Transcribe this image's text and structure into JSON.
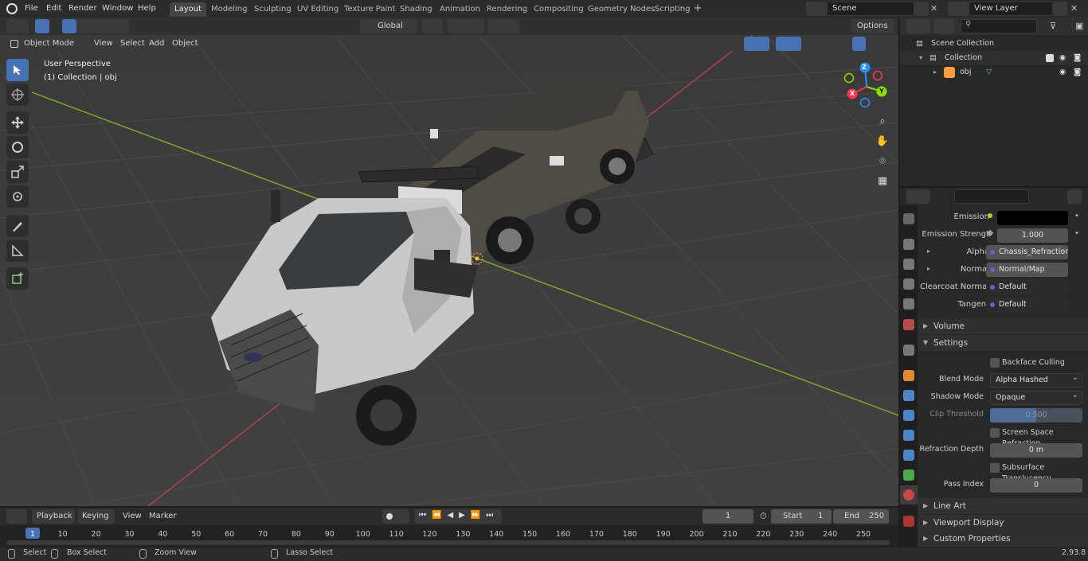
{
  "app": {
    "version": "2.93.8"
  },
  "top_menu": [
    "File",
    "Edit",
    "Render",
    "Window",
    "Help"
  ],
  "workspace_tabs": [
    "Layout",
    "Modeling",
    "Sculpting",
    "UV Editing",
    "Texture Paint",
    "Shading",
    "Animation",
    "Rendering",
    "Compositing",
    "Geometry Nodes",
    "Scripting"
  ],
  "active_tab": "Layout",
  "scene": {
    "name": "Scene"
  },
  "view_layer": {
    "name": "View Layer"
  },
  "viewport_header": {
    "mode": "Object Mode",
    "menus": [
      "View",
      "Select",
      "Add",
      "Object"
    ],
    "transform_orientation": "Global",
    "options": "Options"
  },
  "viewport": {
    "perspective_label": "User Perspective",
    "collection_label": "(1) Collection | obj",
    "gizmo_axes": [
      "Z",
      "Y",
      "X"
    ]
  },
  "outliner": {
    "root": "Scene Collection",
    "collection": "Collection",
    "object": "obj"
  },
  "properties": {
    "rows_top": [
      {
        "label": "Emission",
        "value": "",
        "kind": "color",
        "color": "#000000"
      },
      {
        "label": "Emission Strengt",
        "value": "1.000",
        "kind": "number"
      },
      {
        "label": "Alpha",
        "value": "Chassis_Refraction_i...",
        "kind": "link"
      },
      {
        "label": "Normal",
        "value": "Normal/Map",
        "kind": "link"
      },
      {
        "label": "Clearcoat Normal",
        "value": "Default",
        "kind": "link"
      },
      {
        "label": "Tangent",
        "value": "Default",
        "kind": "link"
      }
    ],
    "sections": {
      "volume": "Volume",
      "settings": "Settings",
      "line_art": "Line Art",
      "viewport_display": "Viewport Display",
      "custom_properties": "Custom Properties"
    },
    "settings": {
      "backface_culling": "Backface Culling",
      "blend_mode_label": "Blend Mode",
      "blend_mode": "Alpha Hashed",
      "shadow_mode_label": "Shadow Mode",
      "shadow_mode": "Opaque",
      "clip_threshold_label": "Clip Threshold",
      "clip_threshold": "0.500",
      "ssr": "Screen Space Refraction",
      "refraction_depth_label": "Refraction Depth",
      "refraction_depth": "0 m",
      "subsurface": "Subsurface Translucency",
      "pass_index_label": "Pass Index",
      "pass_index": "0"
    }
  },
  "timeline": {
    "menus": [
      "Playback",
      "Keying",
      "View",
      "Marker"
    ],
    "current_frame": "1",
    "start_label": "Start",
    "start": "1",
    "end_label": "End",
    "end": "250",
    "ticks": [
      "1",
      "10",
      "20",
      "30",
      "40",
      "50",
      "60",
      "70",
      "80",
      "90",
      "100",
      "110",
      "120",
      "130",
      "140",
      "150",
      "160",
      "170",
      "180",
      "190",
      "200",
      "210",
      "220",
      "230",
      "240",
      "250"
    ]
  },
  "statusbar": {
    "select": "Select",
    "box_select": "Box Select",
    "zoom_view": "Zoom View",
    "lasso_select": "Lasso Select"
  },
  "colors": {
    "accent": "#4772b3",
    "x_axis": "#ff3352",
    "y_axis": "#8bdc00",
    "z_axis": "#2890ff"
  }
}
